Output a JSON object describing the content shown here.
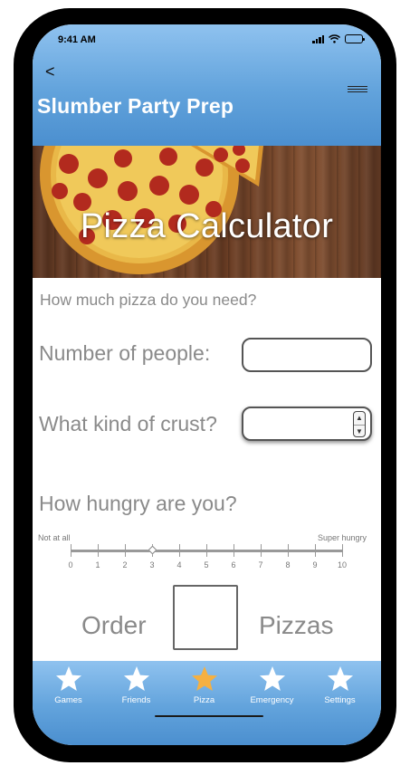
{
  "status_bar": {
    "time": "9:41 AM",
    "icons": [
      "signal-icon",
      "wifi-icon",
      "battery-icon"
    ]
  },
  "header": {
    "back_label": "<",
    "title": "Slumber Party Prep",
    "menu_icon": "hamburger-menu-icon"
  },
  "hero": {
    "title": "Pizza Calculator"
  },
  "form": {
    "subtitle": "How much pizza do you need?",
    "people_label": "Number of people:",
    "people_value": "",
    "crust_label": "What kind of crust?",
    "crust_value": "",
    "hungry_label": "How hungry are you?",
    "hunger_min_label": "Not at all",
    "hunger_max_label": "Super hungry",
    "hunger_ticks": [
      "0",
      "1",
      "2",
      "3",
      "4",
      "5",
      "6",
      "7",
      "8",
      "9",
      "10"
    ],
    "hunger_value": 3
  },
  "result": {
    "prefix": "Order",
    "value": "",
    "suffix": "Pizzas"
  },
  "tabs": [
    {
      "label": "Games",
      "icon": "star-icon",
      "active": false
    },
    {
      "label": "Friends",
      "icon": "star-icon",
      "active": false
    },
    {
      "label": "Pizza",
      "icon": "star-icon",
      "active": true
    },
    {
      "label": "Emergency",
      "icon": "star-icon",
      "active": false
    },
    {
      "label": "Settings",
      "icon": "star-icon",
      "active": false
    }
  ],
  "colors": {
    "header_gradient_top": "#8fc2ef",
    "header_gradient_bottom": "#4b8fcf",
    "active_tab_star": "#f5b041",
    "inactive_tab_star": "#ffffff",
    "muted_text": "#8a8a8a"
  }
}
